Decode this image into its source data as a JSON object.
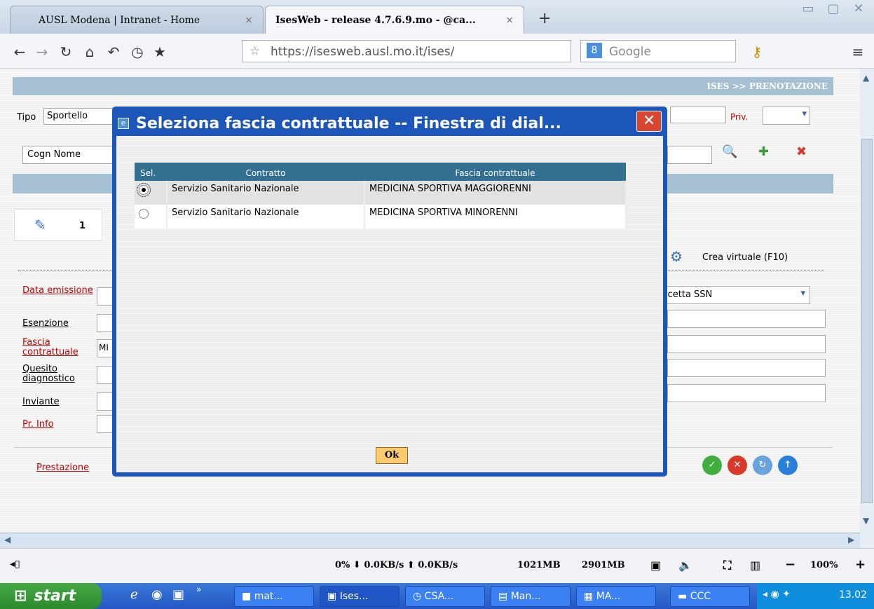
{
  "browser": {
    "tabs": [
      {
        "label": "AUSL Modena | Intranet - Home",
        "close": "×"
      },
      {
        "label": "IsesWeb - release 4.7.6.9.mo - @ca...",
        "close": "×"
      }
    ],
    "new_tab": "+",
    "url": "https://isesweb.ausl.mo.it/ises/",
    "search_placeholder": "Google",
    "window_buttons": [
      "▭",
      "▢",
      "✕"
    ]
  },
  "page": {
    "breadcrumb": "ISES >> PRENOTAZIONE",
    "tipo_label": "Tipo",
    "tipo_value": "Sportello",
    "priv_label": "Priv.",
    "cogn_nome_value": "Cogn Nome",
    "tab_number": "1",
    "crea_virtuale": "Crea virtuale (F10)",
    "ricetta_value": "icetta SSN",
    "fields": [
      {
        "label": "Data emissione",
        "required": true
      },
      {
        "label": "Esenzione",
        "required": false
      },
      {
        "label": "Fascia contrattuale",
        "required": true,
        "value": "MI"
      },
      {
        "label": "Quesito diagnostico",
        "required": false
      },
      {
        "label": "Inviante",
        "required": false
      },
      {
        "label": "Pr. Info",
        "required": true
      }
    ],
    "prestazione_label": "Prestazione"
  },
  "dialog": {
    "title": "Seleziona fascia contrattuale -- Finestra di dial...",
    "columns": [
      "Sel.",
      "Contratto",
      "Fascia contrattuale"
    ],
    "rows": [
      {
        "selected": true,
        "contratto": "Servizio Sanitario Nazionale",
        "fascia": "MEDICINA SPORTIVA MAGGIORENNI"
      },
      {
        "selected": false,
        "contratto": "Servizio Sanitario Nazionale",
        "fascia": "MEDICINA SPORTIVA MINORENNI"
      }
    ],
    "ok_label": "Ok"
  },
  "statusbar": {
    "net": "0%  ⬇ 0.0KB/s  ⬆ 0.0KB/s",
    "mem": "1021MB",
    "disk": "2901MB",
    "zoom_minus": "−",
    "zoom": "100%",
    "zoom_plus": "+"
  },
  "taskbar": {
    "start_label": "start",
    "buttons": [
      "mat...",
      "Ises...",
      "CSA...",
      "Man...",
      "MA...",
      "CCC"
    ],
    "clock": "13.02"
  },
  "colors": {
    "accent": "#1c56b9",
    "header_band": "#a4c0d2",
    "table_header": "#336f90",
    "ok_button": "#fdcb6e"
  }
}
